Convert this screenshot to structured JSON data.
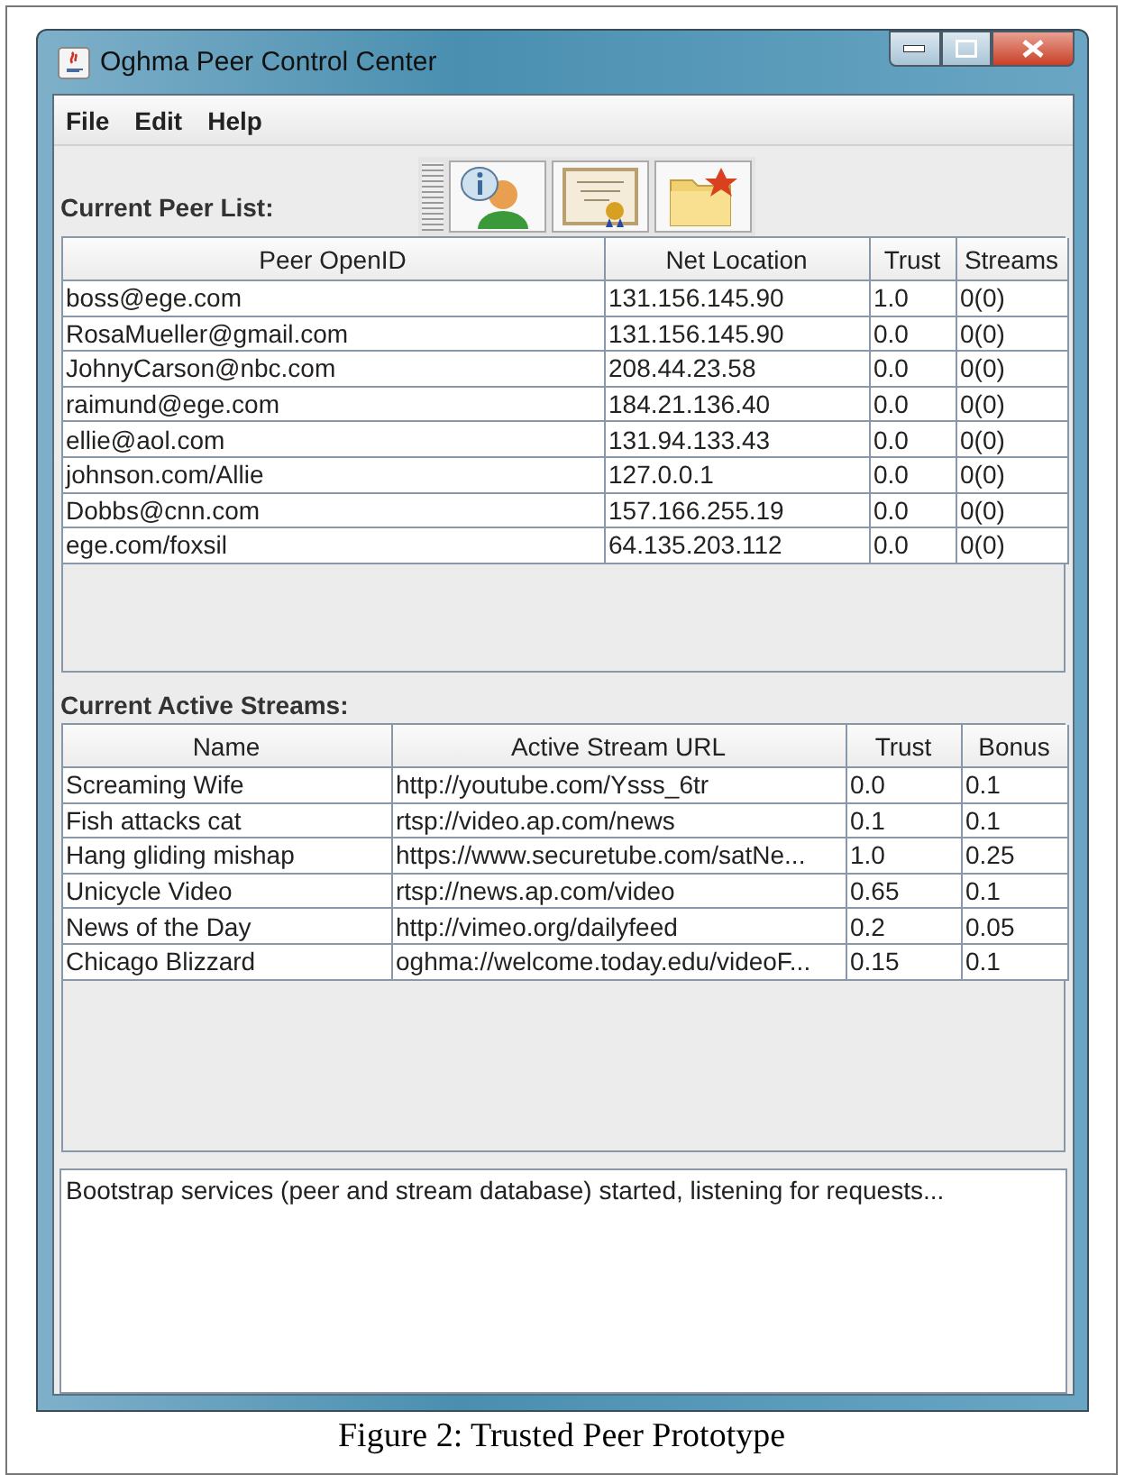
{
  "window": {
    "title": "Oghma Peer Control Center"
  },
  "menu": [
    "File",
    "Edit",
    "Help"
  ],
  "peer_list": {
    "label": "Current Peer List:",
    "columns": [
      "Peer OpenID",
      "Net Location",
      "Trust",
      "Streams"
    ],
    "rows": [
      [
        "boss@ege.com",
        "131.156.145.90",
        "1.0",
        "0(0)"
      ],
      [
        "RosaMueller@gmail.com",
        "131.156.145.90",
        "0.0",
        "0(0)"
      ],
      [
        "JohnyCarson@nbc.com",
        "208.44.23.58",
        "0.0",
        "0(0)"
      ],
      [
        "raimund@ege.com",
        "184.21.136.40",
        "0.0",
        "0(0)"
      ],
      [
        "ellie@aol.com",
        "131.94.133.43",
        "0.0",
        "0(0)"
      ],
      [
        "johnson.com/Allie",
        "127.0.0.1",
        "0.0",
        "0(0)"
      ],
      [
        "Dobbs@cnn.com",
        "157.166.255.19",
        "0.0",
        "0(0)"
      ],
      [
        "ege.com/foxsil",
        "64.135.203.112",
        "0.0",
        "0(0)"
      ]
    ]
  },
  "streams": {
    "label": "Current Active Streams:",
    "columns": [
      "Name",
      "Active Stream URL",
      "Trust",
      "Bonus"
    ],
    "rows": [
      [
        "Screaming Wife",
        "http://youtube.com/Ysss_6tr",
        "0.0",
        "0.1"
      ],
      [
        "Fish attacks cat",
        "rtsp://video.ap.com/news",
        "0.1",
        "0.1"
      ],
      [
        "Hang gliding mishap",
        "https://www.securetube.com/satNe...",
        "1.0",
        "0.25"
      ],
      [
        "Unicycle Video",
        "rtsp://news.ap.com/video",
        "0.65",
        "0.1"
      ],
      [
        "News of the Day",
        "http://vimeo.org/dailyfeed",
        "0.2",
        "0.05"
      ],
      [
        "Chicago Blizzard",
        "oghma://welcome.today.edu/videoF...",
        "0.15",
        "0.1"
      ]
    ]
  },
  "log": "Bootstrap services (peer and stream database) started, listening for requests...",
  "caption": "Figure 2: Trusted Peer Prototype"
}
